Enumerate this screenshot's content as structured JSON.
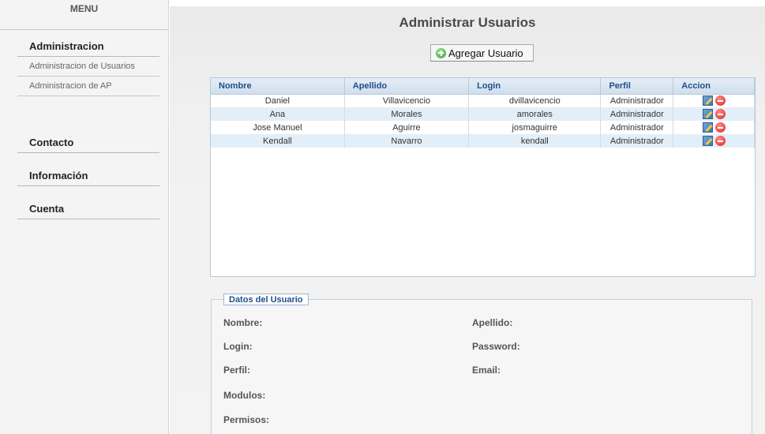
{
  "sidebar": {
    "menu_title": "MENU",
    "sections": [
      {
        "label": "Administracion",
        "items": [
          "Administracion de Usuarios",
          "Administracion de AP"
        ]
      },
      {
        "label": "Contacto"
      },
      {
        "label": "Información"
      },
      {
        "label": "Cuenta"
      }
    ]
  },
  "main": {
    "title": "Administrar Usuarios",
    "add_button": "Agregar Usuario"
  },
  "grid": {
    "columns": [
      "Nombre",
      "Apellido",
      "Login",
      "Perfil",
      "Accion"
    ],
    "rows": [
      [
        "Daniel",
        "Villavicencio",
        "dvillavicencio",
        "Administrador"
      ],
      [
        "Ana",
        "Morales",
        "amorales",
        "Administrador"
      ],
      [
        "Jose Manuel",
        "Aguirre",
        "josmaguirre",
        "Administrador"
      ],
      [
        "Kendall",
        "Navarro",
        "kendall",
        "Administrador"
      ]
    ]
  },
  "details": {
    "legend": "Datos del Usuario",
    "labels": {
      "nombre": "Nombre:",
      "apellido": "Apellido:",
      "login": "Login:",
      "password": "Password:",
      "perfil": "Perfil:",
      "email": "Email:",
      "modulos": "Modulos:",
      "permisos": "Permisos:"
    }
  },
  "icons": {
    "add": "plus-circle-icon",
    "edit": "edit-icon",
    "delete": "delete-icon"
  },
  "colors": {
    "header_text": "#1d4f8a",
    "row_alt": "#e3eff8",
    "add_icon": "#3c9e35",
    "delete_icon": "#e02424"
  }
}
